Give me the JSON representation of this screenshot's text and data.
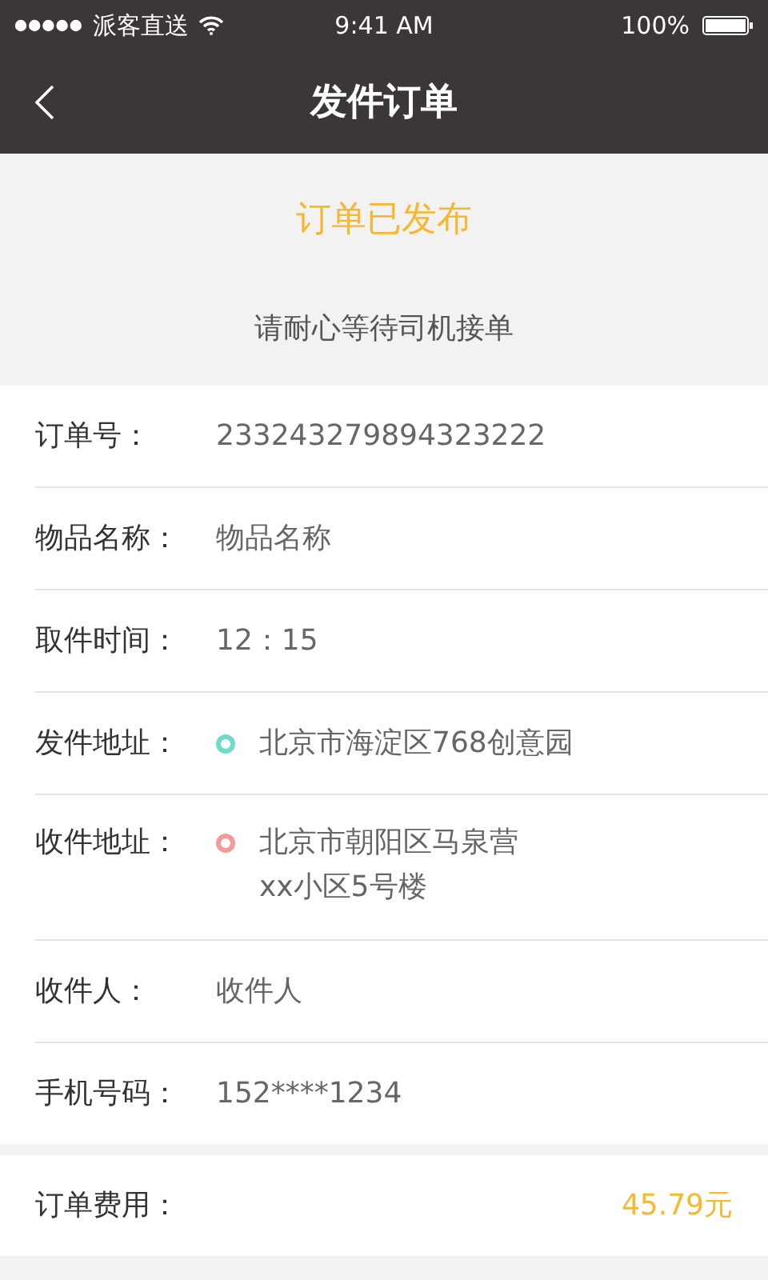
{
  "status_bar": {
    "carrier": "派客直送",
    "time": "9:41 AM",
    "battery": "100%"
  },
  "nav": {
    "title": "发件订单"
  },
  "banner": {
    "status": "订单已发布",
    "message": "请耐心等待司机接单"
  },
  "details": [
    {
      "kind": "text",
      "label": "订单号：",
      "value": "233243279894323222"
    },
    {
      "kind": "text",
      "label": "物品名称：",
      "value": "物品名称"
    },
    {
      "kind": "text",
      "label": "取件时间：",
      "value": "12：15"
    },
    {
      "kind": "address",
      "label": "发件地址：",
      "color": "#6edccb",
      "lines": [
        "北京市海淀区768创意园"
      ]
    },
    {
      "kind": "address",
      "label": "收件地址：",
      "color": "#f59a98",
      "lines": [
        "北京市朝阳区马泉营",
        "xx小区5号楼"
      ]
    },
    {
      "kind": "text",
      "label": "收件人：",
      "value": "收件人"
    },
    {
      "kind": "text",
      "label": "手机号码：",
      "value": "152****1234"
    }
  ],
  "fee": {
    "label": "订单费用：",
    "value": "45.79元"
  }
}
